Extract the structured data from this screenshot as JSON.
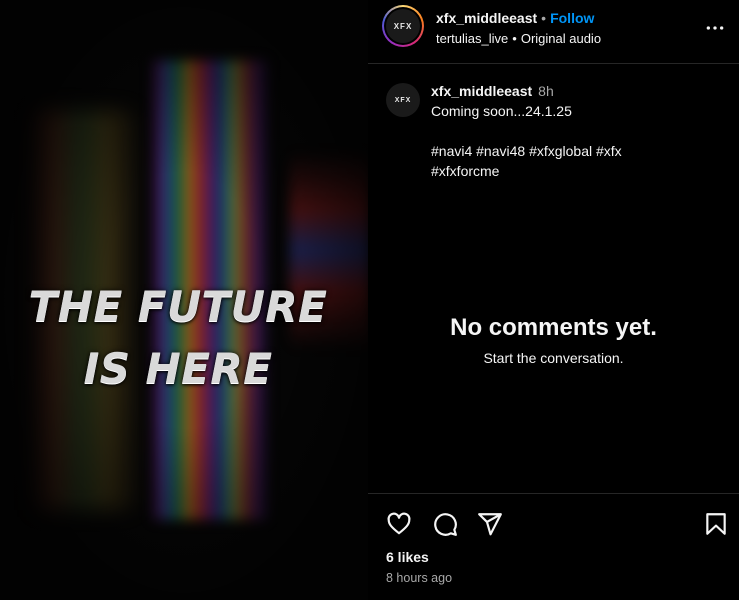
{
  "media": {
    "headline_line1": "THE FUTURE",
    "headline_line2": "IS HERE"
  },
  "header": {
    "avatar_text": "XFX",
    "username": "xfx_middleeast",
    "separator": "•",
    "follow_label": "Follow",
    "audio_user": "tertulias_live",
    "audio_label": "Original audio",
    "more_icon": "more-horizontal-icon"
  },
  "caption": {
    "avatar_text": "XFX",
    "username": "xfx_middleeast",
    "time": "8h",
    "text": "Coming soon...24.1.25",
    "tags_line1": "#navi4 #navi48 #xfxglobal #xfx",
    "tags_line2": "#xfxforcme"
  },
  "comments": {
    "empty_title": "No comments yet.",
    "empty_subtitle": "Start the conversation."
  },
  "actions": {
    "like_icon": "heart-icon",
    "comment_icon": "comment-icon",
    "share_icon": "send-icon",
    "save_icon": "bookmark-icon",
    "likes": "6 likes",
    "time_ago": "8 hours ago"
  },
  "colors": {
    "background": "#000000",
    "text": "#f5f5f5",
    "muted": "#a8a8a8",
    "follow": "#0095f6",
    "divider": "#262626"
  }
}
